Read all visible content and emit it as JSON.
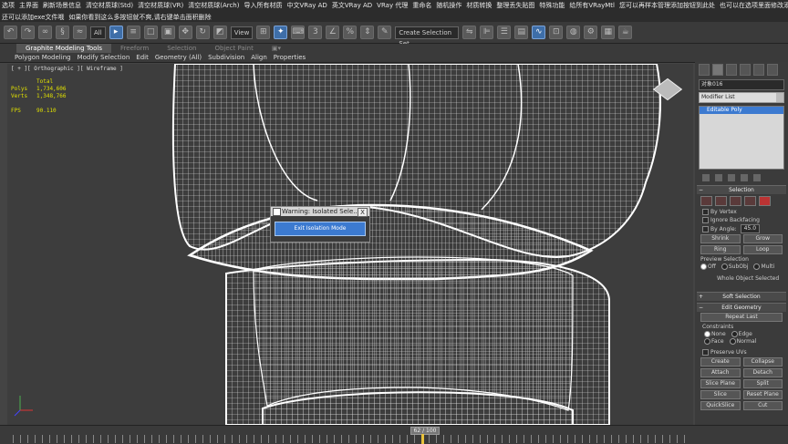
{
  "menu": {
    "row1": [
      "选项",
      "主界面",
      "刷新场景信息",
      "清空材质球(Std)",
      "清空材质球(VR)",
      "清空材质球(Arch)",
      "导入所有材质",
      "中文VRay AD",
      "英文VRay AD",
      "VRay 代理",
      "重命名",
      "随机操作",
      "材质转换",
      "整理丢失贴图",
      "特殊功能",
      "给所有VRayMtl",
      "您可以再样本管理添加按钮到此处",
      "也可以在选项里面修改添加按钮"
    ],
    "row2": [
      "还可以添加exe文件哦",
      "如果你看到这么多按钮就不爽,请右键单击面积删除"
    ]
  },
  "toolbar": {
    "filter_value": "All",
    "view_value": "View",
    "selection_set_placeholder": "Create Selection Set"
  },
  "ribbon": {
    "tabs": [
      "Graphite Modeling Tools",
      "Freeform",
      "Selection",
      "Object Paint"
    ],
    "subtabs": [
      "Polygon Modeling",
      "Modify Selection",
      "Edit",
      "Geometry (All)",
      "Subdivision",
      "Align",
      "Properties"
    ]
  },
  "viewport": {
    "label": "[ + ][ Orthographic ][ Wireframe ]",
    "stats_header": "Total",
    "stats": [
      {
        "label": "Polys",
        "value": "1,734,606"
      },
      {
        "label": "Verts",
        "value": "1,348,766"
      }
    ],
    "fps_label": "FPS",
    "fps_value": "90.110"
  },
  "warning": {
    "title": "Warning: Isolated Sele...",
    "close": "X",
    "button": "Exit Isolation Mode"
  },
  "command_panel": {
    "object_name": "对象016",
    "modifier_list": "Modifier List",
    "stack_item": "Editable Poly",
    "selection_title": "Selection",
    "by_vertex": "By Vertex",
    "ignore_backfacing": "Ignore Backfacing",
    "by_angle": "By Angle:",
    "by_angle_value": "45.0",
    "shrink": "Shrink",
    "grow": "Grow",
    "ring": "Ring",
    "loop": "Loop",
    "preview_selection": "Preview Selection",
    "preview_off": "Off",
    "preview_subobj": "SubObj",
    "preview_multi": "Multi",
    "whole_object": "Whole Object Selected",
    "soft_selection": "Soft Selection",
    "edit_geometry": "Edit Geometry",
    "repeat_last": "Repeat Last",
    "constraints": "Constraints",
    "c_none": "None",
    "c_edge": "Edge",
    "c_face": "Face",
    "c_normal": "Normal",
    "preserve_uvs": "Preserve UVs",
    "create": "Create",
    "collapse": "Collapse",
    "attach": "Attach",
    "detach": "Detach",
    "slice_plane": "Slice Plane",
    "split": "Split",
    "slice": "Slice",
    "reset_plane": "Reset Plane",
    "quickslice": "QuickSlice",
    "cut": "Cut"
  },
  "timeline": {
    "frame_display": "62 / 100"
  }
}
